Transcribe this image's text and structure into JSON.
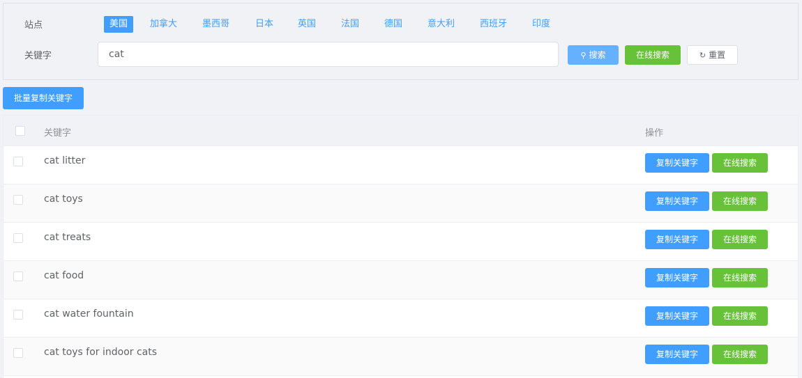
{
  "filter": {
    "site_label": "站点",
    "keyword_label": "关键字",
    "sites": [
      "美国",
      "加拿大",
      "墨西哥",
      "日本",
      "英国",
      "法国",
      "德国",
      "意大利",
      "西班牙",
      "印度"
    ],
    "active_site": "美国",
    "keyword_value": "cat",
    "search_label": "搜索",
    "online_search_label": "在线搜索",
    "reset_label": "重置"
  },
  "batch_copy_label": "批量复制关键字",
  "table": {
    "header_keyword": "关键字",
    "header_action": "操作",
    "copy_label": "复制关键字",
    "online_label": "在线搜索",
    "rows": [
      {
        "keyword": "cat litter"
      },
      {
        "keyword": "cat toys"
      },
      {
        "keyword": "cat treats"
      },
      {
        "keyword": "cat food"
      },
      {
        "keyword": "cat water fountain"
      },
      {
        "keyword": "cat toys for indoor cats"
      },
      {
        "keyword": ""
      }
    ]
  },
  "colors": {
    "primary": "#409eff",
    "primary_light": "#66b1ff",
    "success": "#67c23a",
    "background": "#f0f2f5"
  }
}
